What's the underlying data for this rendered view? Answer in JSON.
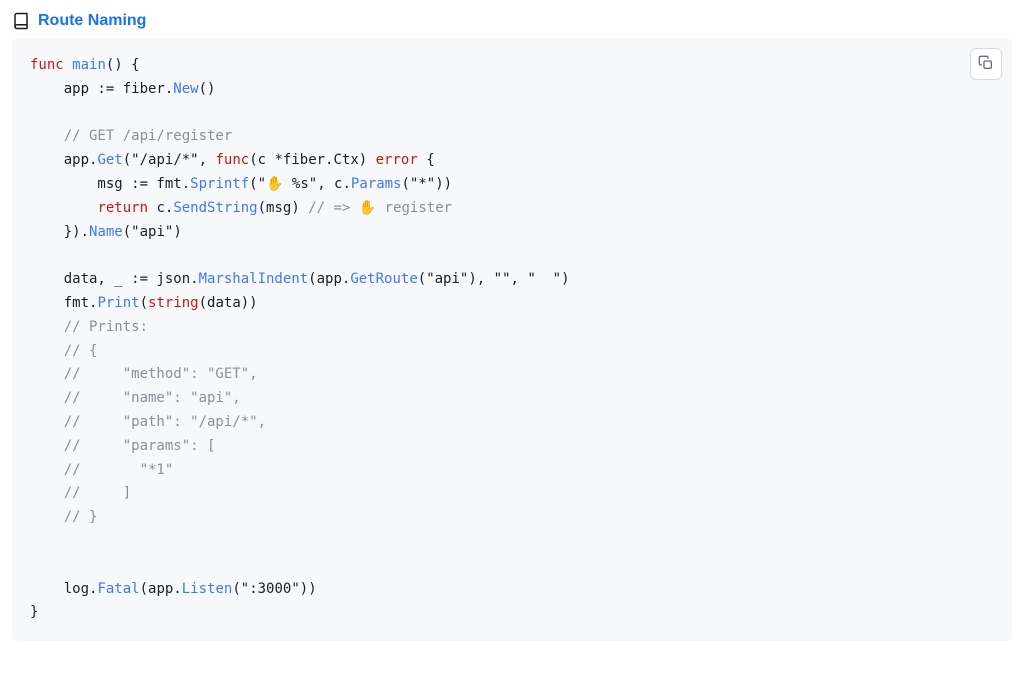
{
  "heading": {
    "icon": "book-icon",
    "link_text": "Route Naming"
  },
  "copy_button": {
    "aria_label": "Copy code to clipboard"
  },
  "code": {
    "l1": {
      "a": "func",
      "b": " ",
      "c": "main",
      "d": "() {"
    },
    "l2": {
      "a": "    app := fiber.",
      "b": "New",
      "c": "()"
    },
    "l3": "",
    "l4": "    // GET /api/register",
    "l5": {
      "a": "    app.",
      "b": "Get",
      "c": "(",
      "d": "\"/api/*\"",
      "e": ", ",
      "f": "func",
      "g": "(c *fiber.Ctx) ",
      "h": "error",
      "i": " {"
    },
    "l6": {
      "a": "        msg := fmt.",
      "b": "Sprintf",
      "c": "(",
      "d": "\"✋ %s\"",
      "e": ", c.",
      "f": "Params",
      "g": "(",
      "h": "\"*\"",
      "i": "))"
    },
    "l7": {
      "a": "        ",
      "b": "return",
      "c": " c.",
      "d": "SendString",
      "e": "(msg) ",
      "f": "// => ✋ register"
    },
    "l8": {
      "a": "    }).",
      "b": "Name",
      "c": "(",
      "d": "\"api\"",
      "e": ")"
    },
    "l9": "",
    "l10": {
      "a": "    data, _ := json.",
      "b": "MarshalIndent",
      "c": "(app.",
      "d": "GetRoute",
      "e": "(",
      "f": "\"api\"",
      "g": "), ",
      "h": "\"\"",
      "i": ", ",
      "j": "\"  \"",
      "k": ")"
    },
    "l11": {
      "a": "    fmt.",
      "b": "Print",
      "c": "(",
      "d": "string",
      "e": "(data))"
    },
    "l12": "    // Prints:",
    "l13": "    // {",
    "l14": "    //     \"method\": \"GET\",",
    "l15": "    //     \"name\": \"api\",",
    "l16": "    //     \"path\": \"/api/*\",",
    "l17": "    //     \"params\": [",
    "l18": "    //       \"*1\"",
    "l19": "    //     ]",
    "l20": "    // }",
    "l21": "",
    "l22": "",
    "l23": {
      "a": "    log.",
      "b": "Fatal",
      "c": "(app.",
      "d": "Listen",
      "e": "(",
      "f": "\":3000\"",
      "g": "))"
    },
    "l24": "}"
  }
}
